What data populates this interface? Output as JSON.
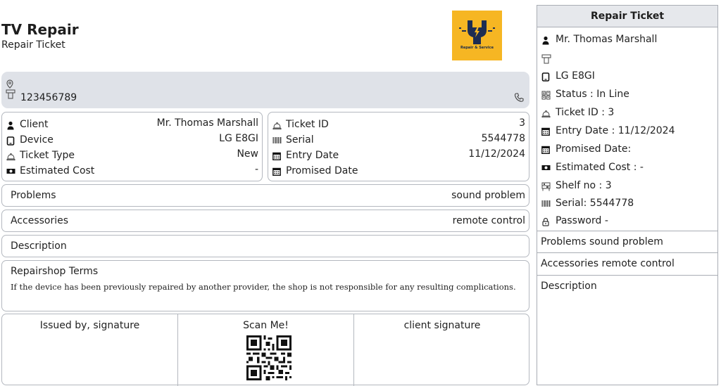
{
  "header": {
    "title": "TV Repair",
    "subtitle": "Repair Ticket",
    "logo_text": "Repair & Service"
  },
  "contact": {
    "phone": "123456789"
  },
  "client_card": {
    "rows": [
      {
        "label": "Client",
        "value": "Mr. Thomas Marshall",
        "icon": "person-icon"
      },
      {
        "label": "Device",
        "value": "LG E8GI",
        "icon": "tablet-icon"
      },
      {
        "label": "Ticket Type",
        "value": "New",
        "icon": "bell-icon"
      },
      {
        "label": "Estimated Cost",
        "value": "-",
        "icon": "cash-icon"
      }
    ]
  },
  "ticket_card": {
    "rows": [
      {
        "label": "Ticket ID",
        "value": "3",
        "icon": "bell-icon"
      },
      {
        "label": "Serial",
        "value": "5544778",
        "icon": "barcode-icon"
      },
      {
        "label": "Entry Date",
        "value": "11/12/2024",
        "icon": "calendar-icon"
      },
      {
        "label": "Promised Date",
        "value": "",
        "icon": "calendar-icon"
      }
    ]
  },
  "problems": {
    "label": "Problems",
    "value": "sound problem"
  },
  "accessories": {
    "label": "Accessories",
    "value": "remote control"
  },
  "description": {
    "label": "Description"
  },
  "terms": {
    "title": "Repairshop Terms",
    "text": "If the device has been previously repaired by another provider, the shop is not responsible for any resulting complications."
  },
  "signatures": {
    "issued_by": "Issued by, signature",
    "scan": "Scan Me!",
    "client": "client signature"
  },
  "side": {
    "title": "Repair Ticket",
    "client": "Mr. Thomas Marshall",
    "mobile": "",
    "device": "LG E8GI",
    "status": "Status :  In Line",
    "ticket_id": "Ticket ID :  3",
    "entry_date": "Entry Date :  11/12/2024",
    "promised_date": "Promised Date:",
    "estimated_cost": "Estimated Cost :  -",
    "shelf_no": "Shelf no :  3",
    "serial": "Serial:  5544778",
    "password": "Password  -",
    "problems": "Problems  sound problem",
    "accessories": "Accessories  remote control",
    "description": "Description"
  },
  "colors": {
    "logo_bg": "#f6b623",
    "contact_bg": "#dfe2e8",
    "border": "#b4b8bf"
  }
}
